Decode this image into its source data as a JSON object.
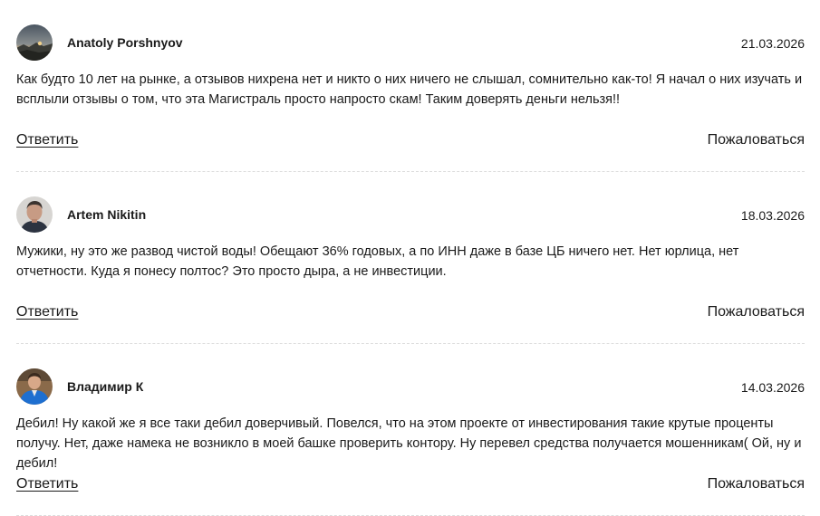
{
  "comments": [
    {
      "author": "Anatoly Porshnyov",
      "date": "21.03.2026",
      "text": "Как будто 10 лет на рынке, а отзывов нихрена нет и никто о них ничего не слышал, сомнительно как-то! Я начал о них изучать и всплыли отзывы о том, что эта Магистраль просто напросто скам! Таким доверять деньги нельзя!!",
      "reply_label": "Ответить",
      "report_label": "Пожаловаться",
      "avatar_icon": "landscape-photo-avatar"
    },
    {
      "author": "Artem Nikitin",
      "date": "18.03.2026",
      "text": "Мужики, ну это же развод чистой воды! Обещают 36% годовых, а по ИНН даже в базе ЦБ ничего нет. Нет юрлица, нет отчетности. Куда я понесу полтос? Это просто дыра, а не инвестиции.",
      "reply_label": "Ответить",
      "report_label": "Пожаловаться",
      "avatar_icon": "man-portrait-avatar"
    },
    {
      "author": "Владимир К",
      "date": "14.03.2026",
      "text": "Дебил! Ну какой же я все таки дебил доверчивый. Повелся, что на этом проекте от инвестирования такие крутые проценты получу. Нет, даже намека не возникло в моей башке проверить контору. Ну перевел средства получается мошенникам( Ой, ну и дебил!",
      "reply_label": "Ответить",
      "report_label": "Пожаловаться",
      "avatar_icon": "man-in-blue-jacket-avatar"
    }
  ],
  "colors": {
    "text": "#1a1a1a",
    "divider": "#dcdcdc",
    "background": "#ffffff"
  }
}
